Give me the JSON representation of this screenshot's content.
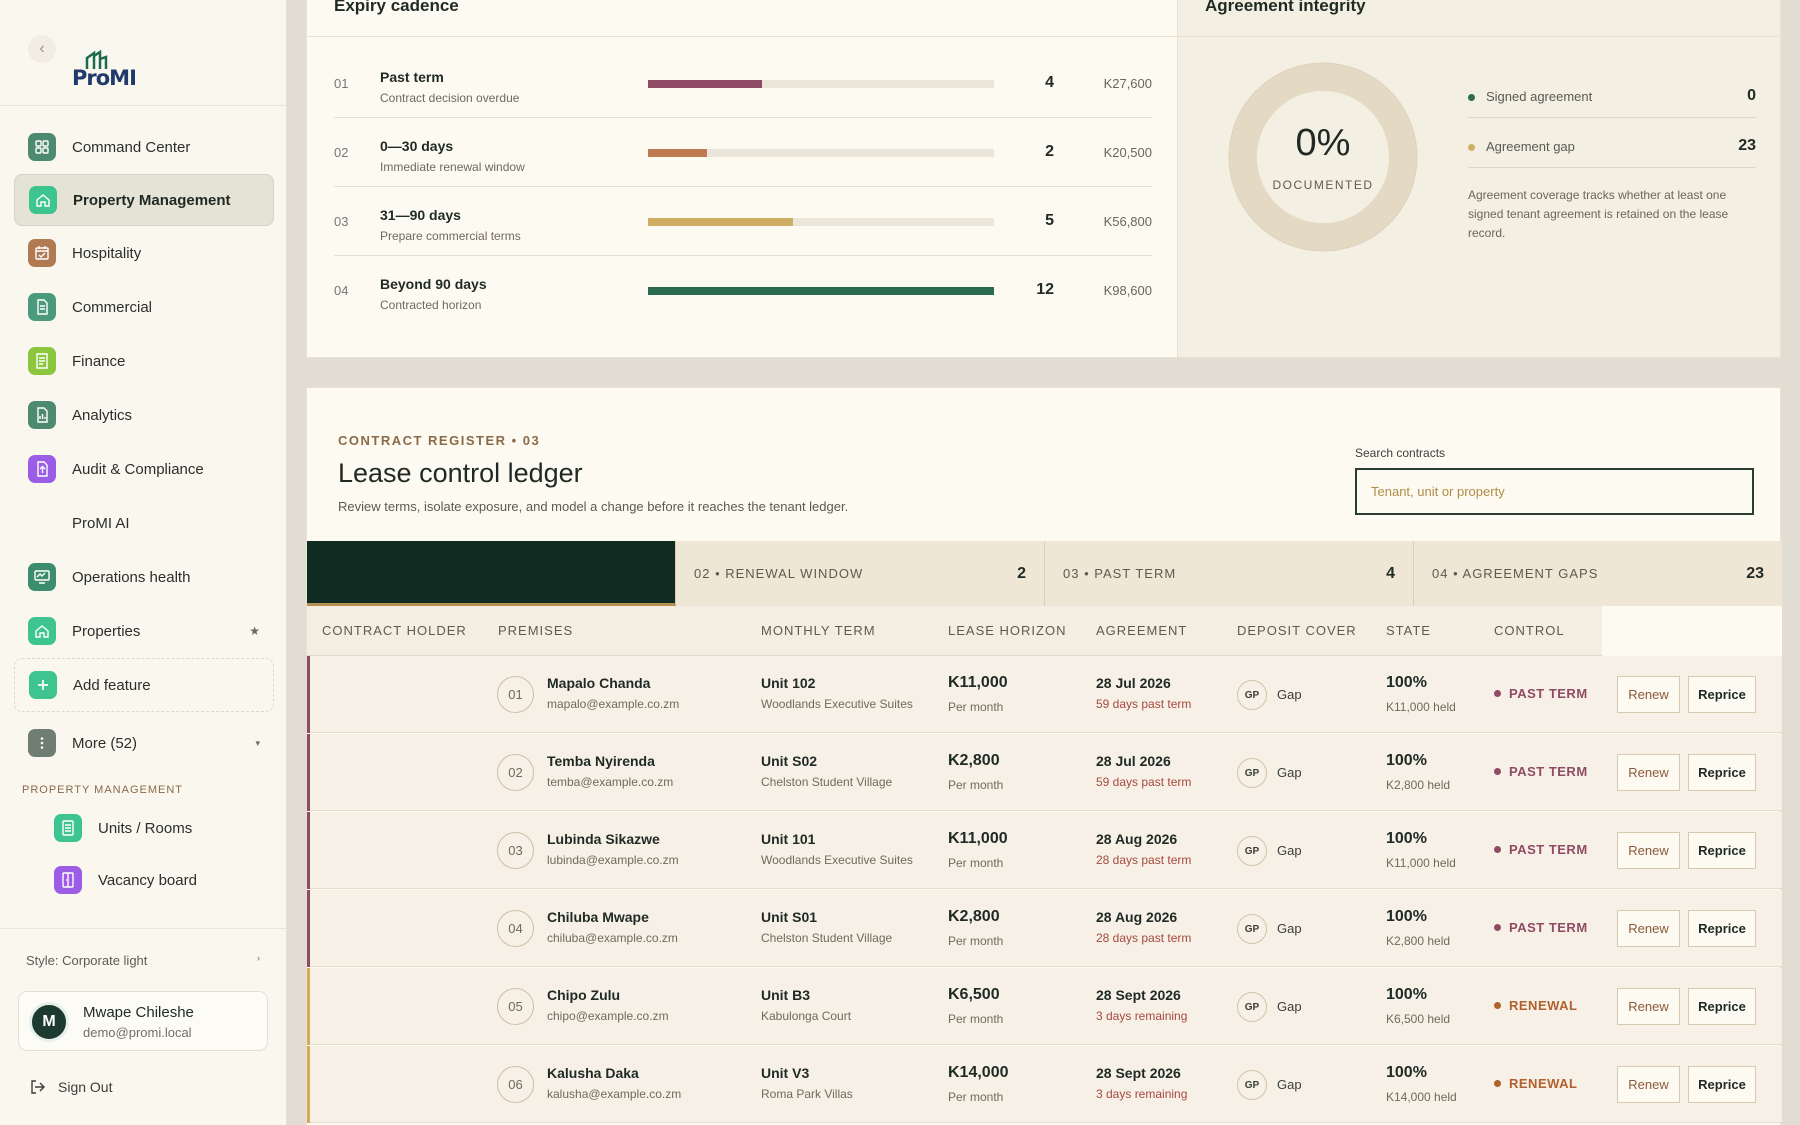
{
  "sidebar": {
    "brand": "ProMI",
    "nav": [
      {
        "label": "Command Center",
        "icon": "grid-icon",
        "color": "#4e8a6f"
      },
      {
        "label": "Property Management",
        "icon": "home-icon",
        "color": "#3ec48e",
        "active": true
      },
      {
        "label": "Hospitality",
        "icon": "calendar-icon",
        "color": "#b07a52"
      },
      {
        "label": "Commercial",
        "icon": "document-icon",
        "color": "#4b9a7d"
      },
      {
        "label": "Finance",
        "icon": "receipt-icon",
        "color": "#8cc63f"
      },
      {
        "label": "Analytics",
        "icon": "chart-doc-icon",
        "color": "#4e8a6f"
      },
      {
        "label": "Audit & Compliance",
        "icon": "upload-doc-icon",
        "color": "#9b5de5"
      },
      {
        "label": "ProMI AI",
        "icon": "",
        "color": ""
      },
      {
        "label": "Operations health",
        "icon": "monitor-icon",
        "color": "#3c8d6d"
      },
      {
        "label": "Properties",
        "icon": "home-icon",
        "color": "#3ec48e"
      }
    ],
    "add_feature": "Add feature",
    "more": "More (52)",
    "section": "PROPERTY MANAGEMENT",
    "sub_items": [
      {
        "label": "Units / Rooms",
        "color": "#3ec48e"
      },
      {
        "label": "Vacancy board",
        "color": "#9b5de5"
      }
    ],
    "style_label": "Style: Corporate light",
    "user": {
      "initial": "M",
      "name": "Mwape Chileshe",
      "email": "demo@promi.local"
    },
    "sign_out": "Sign Out"
  },
  "expiry": {
    "title": "Expiry cadence",
    "rows": [
      {
        "idx": "01",
        "title": "Past term",
        "sub": "Contract decision overdue",
        "fraction": 0.33,
        "color": "#8f4b63",
        "count": "4",
        "value": "K27,600"
      },
      {
        "idx": "02",
        "title": "0—30 days",
        "sub": "Immediate renewal window",
        "fraction": 0.17,
        "color": "#c07a52",
        "count": "2",
        "value": "K20,500"
      },
      {
        "idx": "03",
        "title": "31—90 days",
        "sub": "Prepare commercial terms",
        "fraction": 0.42,
        "color": "#cfae63",
        "count": "5",
        "value": "K56,800"
      },
      {
        "idx": "04",
        "title": "Beyond 90 days",
        "sub": "Contracted horizon",
        "fraction": 1.0,
        "color": "#2a6a4f",
        "count": "12",
        "value": "K98,600"
      }
    ]
  },
  "integrity": {
    "title": "Agreement integrity",
    "percent": "0%",
    "caption": "DOCUMENTED",
    "legend": [
      {
        "name": "Signed agreement",
        "value": "0",
        "color": "#2f6b4f"
      },
      {
        "name": "Agreement gap",
        "value": "23",
        "color": "#cfae63"
      }
    ],
    "note": "Agreement coverage tracks whether at least one signed tenant agreement is retained on the lease record."
  },
  "ledger": {
    "eyebrow": "CONTRACT REGISTER • 03",
    "title": "Lease control ledger",
    "desc": "Review terms, isolate exposure, and model a change before it reaches the tenant ledger.",
    "search_label": "Search contracts",
    "search_placeholder": "Tenant, unit or property",
    "tabs": [
      {
        "label": "",
        "count": "",
        "dark": true
      },
      {
        "label": "02 • RENEWAL WINDOW",
        "count": "2"
      },
      {
        "label": "03 • PAST TERM",
        "count": "4"
      },
      {
        "label": "04 • AGREEMENT GAPS",
        "count": "23"
      }
    ],
    "columns": [
      "CONTRACT HOLDER",
      "PREMISES",
      "MONTHLY TERM",
      "LEASE HORIZON",
      "AGREEMENT",
      "DEPOSIT COVER",
      "STATE",
      "CONTROL"
    ],
    "renew_label": "Renew",
    "reprice_label": "Reprice",
    "rows": [
      {
        "num": "01",
        "name": "Mapalo Chanda",
        "email": "mapalo@example.co.zm",
        "unit": "Unit 102",
        "property": "Woodlands Executive Suites",
        "amount": "K11,000",
        "per": "Per month",
        "date": "28 Jul 2026",
        "note": "59 days past term",
        "gp": "GP",
        "agreement": "Gap",
        "deposit": "100%",
        "held": "K11,000 held",
        "state": "PAST TERM",
        "state_color": "#8f4b63",
        "accent": "#8f4b63"
      },
      {
        "num": "02",
        "name": "Temba Nyirenda",
        "email": "temba@example.co.zm",
        "unit": "Unit S02",
        "property": "Chelston Student Village",
        "amount": "K2,800",
        "per": "Per month",
        "date": "28 Jul 2026",
        "note": "59 days past term",
        "gp": "GP",
        "agreement": "Gap",
        "deposit": "100%",
        "held": "K2,800 held",
        "state": "PAST TERM",
        "state_color": "#8f4b63",
        "accent": "#8f4b63"
      },
      {
        "num": "03",
        "name": "Lubinda Sikazwe",
        "email": "lubinda@example.co.zm",
        "unit": "Unit 101",
        "property": "Woodlands Executive Suites",
        "amount": "K11,000",
        "per": "Per month",
        "date": "28 Aug 2026",
        "note": "28 days past term",
        "gp": "GP",
        "agreement": "Gap",
        "deposit": "100%",
        "held": "K11,000 held",
        "state": "PAST TERM",
        "state_color": "#8f4b63",
        "accent": "#8f4b63"
      },
      {
        "num": "04",
        "name": "Chiluba Mwape",
        "email": "chiluba@example.co.zm",
        "unit": "Unit S01",
        "property": "Chelston Student Village",
        "amount": "K2,800",
        "per": "Per month",
        "date": "28 Aug 2026",
        "note": "28 days past term",
        "gp": "GP",
        "agreement": "Gap",
        "deposit": "100%",
        "held": "K2,800 held",
        "state": "PAST TERM",
        "state_color": "#8f4b63",
        "accent": "#8f4b63"
      },
      {
        "num": "05",
        "name": "Chipo Zulu",
        "email": "chipo@example.co.zm",
        "unit": "Unit B3",
        "property": "Kabulonga Court",
        "amount": "K6,500",
        "per": "Per month",
        "date": "28 Sept 2026",
        "note": "3 days remaining",
        "gp": "GP",
        "agreement": "Gap",
        "deposit": "100%",
        "held": "K6,500 held",
        "state": "RENEWAL",
        "state_color": "#b0612e",
        "accent": "#d4a95a"
      },
      {
        "num": "06",
        "name": "Kalusha Daka",
        "email": "kalusha@example.co.zm",
        "unit": "Unit V3",
        "property": "Roma Park Villas",
        "amount": "K14,000",
        "per": "Per month",
        "date": "28 Sept 2026",
        "note": "3 days remaining",
        "gp": "GP",
        "agreement": "Gap",
        "deposit": "100%",
        "held": "K14,000 held",
        "state": "RENEWAL",
        "state_color": "#b0612e",
        "accent": "#d4a95a"
      }
    ]
  }
}
